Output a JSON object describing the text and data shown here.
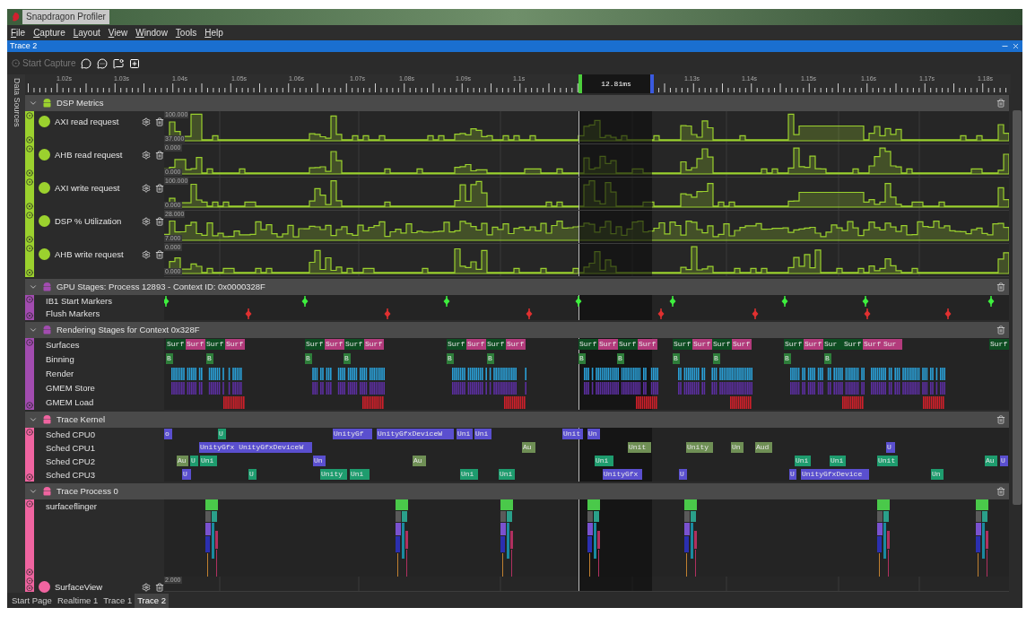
{
  "window": {
    "title": "Snapdragon Profiler"
  },
  "menu": [
    {
      "label": "File"
    },
    {
      "label": "Capture"
    },
    {
      "label": "Layout"
    },
    {
      "label": "View"
    },
    {
      "label": "Window"
    },
    {
      "label": "Tools"
    },
    {
      "label": "Help"
    }
  ],
  "document_tab": {
    "title": "Trace 2"
  },
  "toolbar": {
    "start_capture": {
      "label": "Start Capture",
      "disabled": true
    }
  },
  "data_sources_label": "Data Sources",
  "ruler": {
    "labels": [
      "1.02s",
      "1.03s",
      "1.04s",
      "1.05s",
      "1.06s",
      "1.07s",
      "1.08s",
      "1.09s",
      "1.1s",
      "1.13s",
      "1.14s",
      "1.15s",
      "1.16s",
      "1.17s",
      "1.18s"
    ],
    "selection": "12.81ms"
  },
  "sections": [
    {
      "kind": "metrics",
      "title": "DSP Metrics",
      "color": "#9bd12e",
      "expanded": true,
      "metrics": [
        {
          "name": "AXI read request",
          "max": "100.000",
          "min": "37.000"
        },
        {
          "name": "AHB read request",
          "max": "0.000",
          "min": "0.000"
        },
        {
          "name": "AXI write request",
          "max": "100.000",
          "min": "0.000"
        },
        {
          "name": "DSP % Utilization",
          "max": "28.000",
          "min": "7.000"
        },
        {
          "name": "AHB write request",
          "max": "0.000",
          "min": "0.000"
        }
      ]
    },
    {
      "kind": "tracks",
      "title": "GPU Stages: Process 12893 - Context ID: 0x0000328F",
      "color": "#a24cb0",
      "expanded": true,
      "tracks": [
        {
          "kind": "markers",
          "name": "IB1 Start Markers",
          "color": "#3ef03e"
        },
        {
          "kind": "markers",
          "name": "Flush Markers",
          "color": "#e03030"
        }
      ]
    },
    {
      "kind": "tracks",
      "title": "Rendering Stages for Context 0x328F",
      "color": "#a24cb0",
      "expanded": true,
      "tracks": [
        {
          "kind": "blocks",
          "name": "Surfaces",
          "blocks": [
            {
              "label": "Surf",
              "color": "#0e4d22"
            },
            {
              "label": "Surf",
              "color": "#b33b7c"
            },
            {
              "label": "Surf",
              "color": "#0e4d22"
            },
            {
              "label": "Surf",
              "color": "#b33b7c"
            },
            {
              "label": "Surf",
              "color": "#0e4d22"
            },
            {
              "label": "Surf",
              "color": "#b33b7c"
            },
            {
              "label": "Surf",
              "color": "#0e4d22"
            },
            {
              "label": "Surf",
              "color": "#b33b7c"
            },
            {
              "label": "Surf",
              "color": "#0e4d22"
            },
            {
              "label": "Surf",
              "color": "#b33b7c"
            },
            {
              "label": "Surf",
              "color": "#0e4d22"
            },
            {
              "label": "Surf",
              "color": "#b33b7c"
            },
            {
              "label": "Surf",
              "color": "#0e4d22"
            },
            {
              "label": "Surf",
              "color": "#b33b7c"
            },
            {
              "label": "Surf",
              "color": "#0e4d22"
            },
            {
              "label": "Surf",
              "color": "#b33b7c"
            },
            {
              "label": "Surf",
              "color": "#0e4d22"
            },
            {
              "label": "Surf",
              "color": "#b33b7c"
            },
            {
              "label": "Surf",
              "color": "#0e4d22"
            },
            {
              "label": "Surf",
              "color": "#b33b7c"
            },
            {
              "label": "Surf",
              "color": "#0e4d22"
            },
            {
              "label": "Surf",
              "color": "#b33b7c"
            },
            {
              "label": "Sur",
              "color": "#0e4d22"
            },
            {
              "label": "Surf",
              "color": "#0e4d22"
            },
            {
              "label": "Surf",
              "color": "#b33b7c"
            },
            {
              "label": "Sur",
              "color": "#b33b7c"
            },
            {
              "label": "Surf",
              "color": "#0e4d22"
            }
          ]
        },
        {
          "kind": "blocks",
          "name": "Binning",
          "blocks": [
            {
              "label": "B",
              "color": "#2e7d3a"
            },
            {
              "label": "B",
              "color": "#2e7d3a"
            },
            {
              "label": "B",
              "color": "#2e7d3a"
            },
            {
              "label": "B",
              "color": "#2e7d3a"
            },
            {
              "label": "B",
              "color": "#2e7d3a"
            },
            {
              "label": "B",
              "color": "#2e7d3a"
            },
            {
              "label": "B",
              "color": "#2e7d3a"
            },
            {
              "label": "B",
              "color": "#2e7d3a"
            },
            {
              "label": "B",
              "color": "#2e7d3a"
            },
            {
              "label": "B",
              "color": "#2e7d3a"
            },
            {
              "label": "B",
              "color": "#2e7d3a"
            },
            {
              "label": "B",
              "color": "#2e7d3a"
            }
          ]
        },
        {
          "kind": "bars",
          "name": "Render",
          "color": "#2a9fd6"
        },
        {
          "kind": "bars",
          "name": "GMEM Store",
          "color": "#5b2fa0"
        },
        {
          "kind": "load",
          "name": "GMEM Load",
          "color": "#d0202a"
        }
      ]
    },
    {
      "kind": "tracks",
      "title": "Trace Kernel",
      "color": "#f064a0",
      "expanded": true,
      "tracks": [
        {
          "kind": "blocks",
          "name": "Sched CPU0",
          "blocks": [
            {
              "label": "o",
              "color": "#5a4fcf"
            },
            {
              "label": "U",
              "color": "#1e9c6e"
            },
            {
              "label": "UnityGf",
              "color": "#5a4fcf"
            },
            {
              "label": "UnityGfxDeviceW",
              "color": "#5a4fcf"
            },
            {
              "label": "Uni",
              "color": "#5a4fcf"
            },
            {
              "label": "Uni",
              "color": "#5a4fcf"
            },
            {
              "label": "Unit",
              "color": "#5a4fcf"
            },
            {
              "label": "Un",
              "color": "#5a4fcf"
            }
          ]
        },
        {
          "kind": "blocks",
          "name": "Sched CPU1",
          "blocks": [
            {
              "label": "UnityGfx UnityGfxDeviceW",
              "color": "#5a4fcf"
            },
            {
              "label": "Au",
              "color": "#6f8f55"
            },
            {
              "label": "Unit",
              "color": "#6f8f55"
            },
            {
              "label": "Unity",
              "color": "#6f8f55"
            },
            {
              "label": "Un",
              "color": "#6f8f55"
            },
            {
              "label": "Aud",
              "color": "#6f8f55"
            },
            {
              "label": "U",
              "color": "#5a4fcf"
            }
          ]
        },
        {
          "kind": "blocks",
          "name": "Sched CPU2",
          "blocks": [
            {
              "label": "Au",
              "color": "#6f8f55"
            },
            {
              "label": "U",
              "color": "#1e9c6e"
            },
            {
              "label": "Uni",
              "color": "#1e9c6e"
            },
            {
              "label": "Un",
              "color": "#5a4fcf"
            },
            {
              "label": "Au",
              "color": "#6f8f55"
            },
            {
              "label": "Uni",
              "color": "#1e9c6e"
            },
            {
              "label": "Uni",
              "color": "#1e9c6e"
            },
            {
              "label": "Uni",
              "color": "#1e9c6e"
            },
            {
              "label": "Unit",
              "color": "#1e9c6e"
            },
            {
              "label": "Au",
              "color": "#1e9c6e"
            },
            {
              "label": "U",
              "color": "#5a4fcf"
            }
          ]
        },
        {
          "kind": "blocks",
          "name": "Sched CPU3",
          "blocks": [
            {
              "label": "U",
              "color": "#5a4fcf"
            },
            {
              "label": "U",
              "color": "#1e9c6e"
            },
            {
              "label": "Unity",
              "color": "#1e9c6e"
            },
            {
              "label": "Uni",
              "color": "#1e9c6e"
            },
            {
              "label": "Uni",
              "color": "#1e9c6e"
            },
            {
              "label": "Uni",
              "color": "#1e9c6e"
            },
            {
              "label": "UnityGfx",
              "color": "#5a4fcf"
            },
            {
              "label": "U",
              "color": "#5a4fcf"
            },
            {
              "label": "U",
              "color": "#5a4fcf"
            },
            {
              "label": "UnityGfxDevice",
              "color": "#5a4fcf"
            },
            {
              "label": "Un",
              "color": "#1e9c6e"
            }
          ]
        }
      ]
    },
    {
      "kind": "process",
      "title": "Trace Process 0",
      "color": "#f064a0",
      "expanded": true,
      "tracks": [
        {
          "kind": "threads",
          "name": "surfaceflinger"
        }
      ],
      "metrics": [
        {
          "name": "SurfaceView",
          "max": "2.000"
        }
      ]
    }
  ],
  "bottom_tabs": [
    {
      "label": "Start Page",
      "selected": false
    },
    {
      "label": "Realtime 1",
      "selected": false
    },
    {
      "label": "Trace 1",
      "selected": false
    },
    {
      "label": "Trace 2",
      "selected": true
    }
  ]
}
